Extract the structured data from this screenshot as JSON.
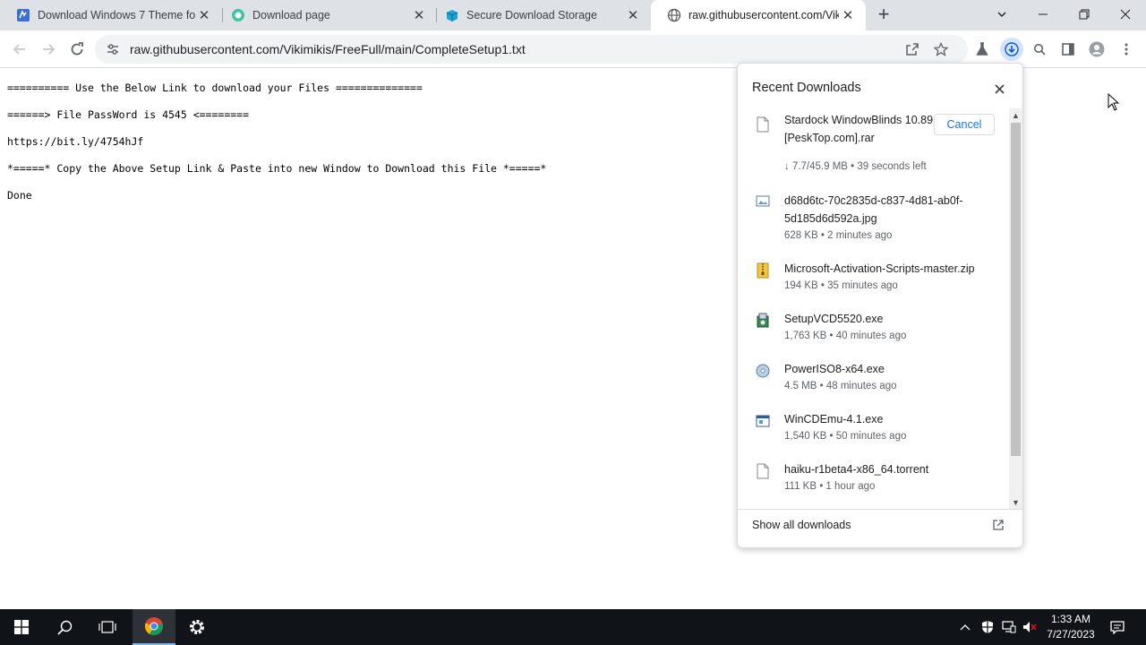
{
  "tabs": [
    {
      "title": "Download Windows 7 Theme fo",
      "active": false,
      "favicon": "blue-logo-icon"
    },
    {
      "title": "Download page",
      "active": false,
      "favicon": "teal-circle-icon"
    },
    {
      "title": "Secure Download Storage",
      "active": false,
      "favicon": "cyan-cube-icon"
    },
    {
      "title": "raw.githubusercontent.com/Vik",
      "active": true,
      "favicon": "globe-icon"
    }
  ],
  "address_bar": {
    "url": "raw.githubusercontent.com/Vikimikis/FreeFull/main/CompleteSetup1.txt"
  },
  "page_text": {
    "line1": "========== Use the Below Link to download your Files ==============",
    "line2": "======> File PassWord is 4545 <========",
    "line3": "https://bit.ly/4754hJf",
    "line4": "*=====* Copy the Above Setup Link & Paste into new Window to Download this File *=====*",
    "line5": "Done"
  },
  "downloads_panel": {
    "title": "Recent Downloads",
    "cancel_label": "Cancel",
    "show_all_label": "Show all downloads",
    "items": [
      {
        "name": "Stardock WindowBlinds 10.89 (x64) [PeskTop.com].rar",
        "meta": "↓ 7.7/45.9 MB • 39 seconds left",
        "icon": "file-icon",
        "in_progress": true
      },
      {
        "name": "d68d6tc-70c2835d-c837-4d81-ab0f-5d185d6d592a.jpg",
        "meta": "628 KB • 2 minutes ago",
        "icon": "image-file-icon"
      },
      {
        "name": "Microsoft-Activation-Scripts-master.zip",
        "meta": "194 KB • 35 minutes ago",
        "icon": "zip-file-icon"
      },
      {
        "name": "SetupVCD5520.exe",
        "meta": "1,763 KB • 40 minutes ago",
        "icon": "installer-icon"
      },
      {
        "name": "PowerISO8-x64.exe",
        "meta": "4.5 MB • 48 minutes ago",
        "icon": "disc-icon"
      },
      {
        "name": "WinCDEmu-4.1.exe",
        "meta": "1,540 KB • 50 minutes ago",
        "icon": "window-app-icon"
      },
      {
        "name": "haiku-r1beta4-x86_64.torrent",
        "meta": "111 KB • 1 hour ago",
        "icon": "file-icon"
      }
    ]
  },
  "taskbar": {
    "time": "1:33 AM",
    "date": "7/27/2023"
  },
  "colors": {
    "accent": "#1a73e8",
    "tabstrip": "#dee1e6",
    "taskbar": "#101419"
  }
}
